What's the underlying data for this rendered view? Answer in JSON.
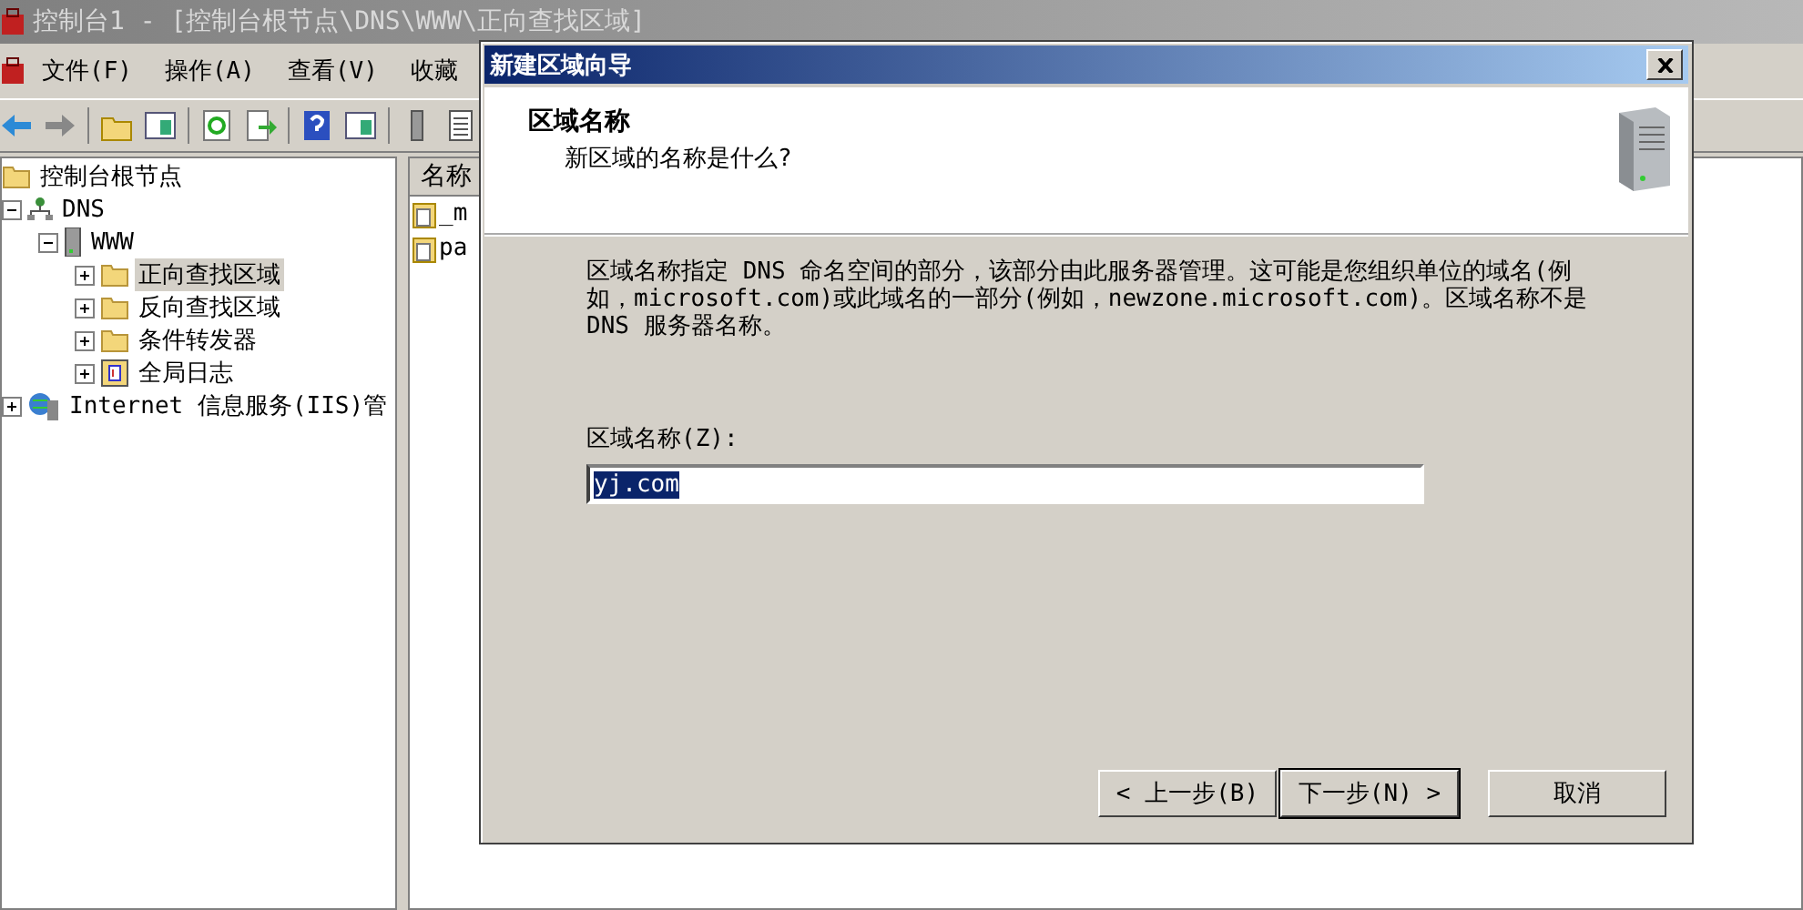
{
  "window": {
    "title": "控制台1 - [控制台根节点\\DNS\\WWW\\正向查找区域]"
  },
  "menu": [
    "文件(F)",
    "操作(A)",
    "查看(V)",
    "收藏"
  ],
  "tree": [
    {
      "label": "控制台根节点",
      "kind": "folder",
      "selected": false,
      "children": [
        {
          "label": "DNS",
          "kind": "dns",
          "expanded": true,
          "selected": false,
          "children": [
            {
              "label": "WWW",
              "kind": "server",
              "expanded": true,
              "selected": false,
              "children": [
                {
                  "label": "正向查找区域",
                  "kind": "folder",
                  "expanded": false,
                  "selected": true
                },
                {
                  "label": "反向查找区域",
                  "kind": "folder",
                  "expanded": false,
                  "selected": false
                },
                {
                  "label": "条件转发器",
                  "kind": "folder",
                  "expanded": false,
                  "selected": false
                },
                {
                  "label": "全局日志",
                  "kind": "log",
                  "expanded": false,
                  "selected": false
                }
              ]
            }
          ]
        },
        {
          "label": "Internet 信息服务(IIS)管",
          "kind": "iis",
          "expanded": false,
          "selected": false
        }
      ]
    }
  ],
  "list": {
    "columns": [
      "名称"
    ],
    "rows": [
      "_m",
      "pa"
    ]
  },
  "dialog": {
    "title": "新建区域向导",
    "header": {
      "title": "区域名称",
      "subtitle": "新区域的名称是什么?"
    },
    "description": "区域名称指定 DNS 命名空间的部分，该部分由此服务器管理。这可能是您组织单位的域名(例如，microsoft.com)或此域名的一部分(例如，newzone.microsoft.com)。区域名称不是 DNS 服务器名称。",
    "field": {
      "label": "区域名称(Z):",
      "value": "yj.com",
      "selected": true
    },
    "buttons": [
      {
        "label": "< 上一步(B)",
        "default": false
      },
      {
        "label": "下一步(N) >",
        "default": true
      },
      {
        "label": "取消",
        "default": false
      }
    ]
  }
}
